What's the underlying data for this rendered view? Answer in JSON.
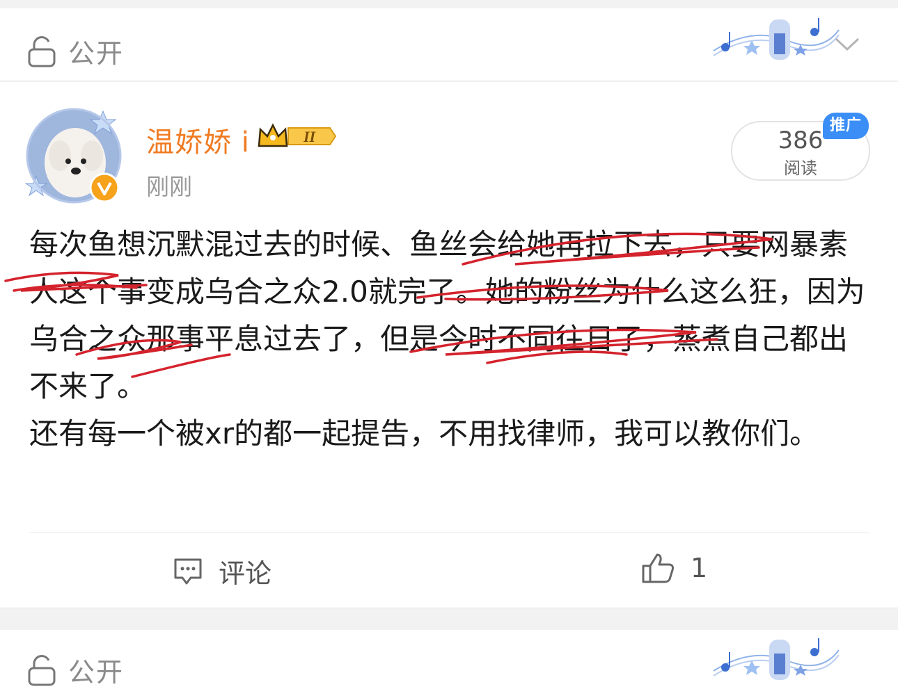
{
  "top_bar": {
    "privacy_label": "公开"
  },
  "post": {
    "author_name": "温娇娇 i",
    "level_badge": "II",
    "time": "刚刚",
    "reads_count": "386",
    "reads_label": "阅读",
    "promo_badge": "推广",
    "paragraphs": [
      "每次鱼想沉默混过去的时候、鱼丝会给她再拉下去，只要网暴素人这个事变成乌合之众2.0就完了。她的粉丝为什么这么狂，因为乌合之众那事平息过去了，但是今时不同往日了，蒸煮自己都出不来了。",
      "还有每一个被xr的都一起提告，不用找律师，我可以教你们。"
    ],
    "actions": {
      "comment_label": "评论",
      "like_count": "1"
    }
  },
  "bottom_bar": {
    "privacy_label": "公开"
  },
  "colors": {
    "name": "#f07b22",
    "promo": "#3a8ef6",
    "scribble": "#d4232d",
    "verified": "#f7a21b"
  },
  "icons": [
    "lock-icon",
    "chevron-down-icon",
    "verified-icon",
    "crown-icon",
    "comment-icon",
    "like-icon"
  ]
}
